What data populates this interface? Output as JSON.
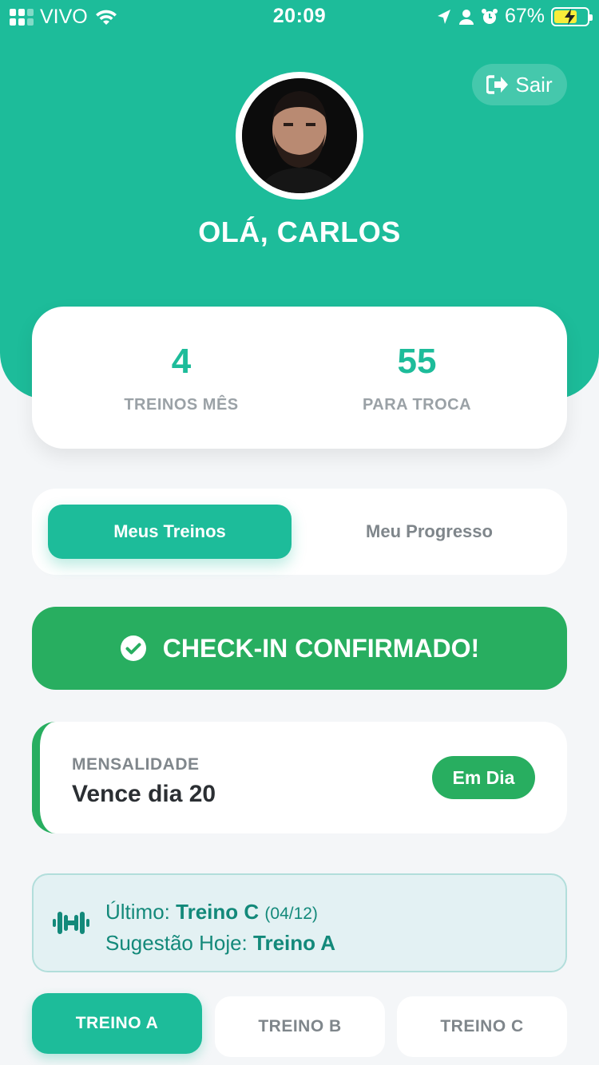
{
  "status_bar": {
    "carrier": "VIVO",
    "time": "20:09",
    "battery": "67%"
  },
  "header": {
    "logout_label": "Sair",
    "greeting": "OLÁ, CARLOS"
  },
  "stats": [
    {
      "value": "4",
      "label": "TREINOS MÊS"
    },
    {
      "value": "55",
      "label": "PARA TROCA"
    }
  ],
  "tabs": {
    "active": "Meus Treinos",
    "inactive": "Meu Progresso"
  },
  "checkin": {
    "label": "CHECK-IN CONFIRMADO!"
  },
  "mensalidade": {
    "label": "MENSALIDADE",
    "value": "Vence dia 20",
    "status": "Em Dia"
  },
  "info": {
    "last_prefix": "Último:",
    "last_workout": "Treino C",
    "last_date": "(04/12)",
    "suggestion_prefix": "Sugestão Hoje:",
    "suggestion": "Treino A"
  },
  "workout_tabs": [
    "TREINO A",
    "TREINO B",
    "TREINO C"
  ],
  "colors": {
    "primary": "#1dbc9a",
    "success": "#28ae60",
    "background": "#f4f6f8"
  }
}
